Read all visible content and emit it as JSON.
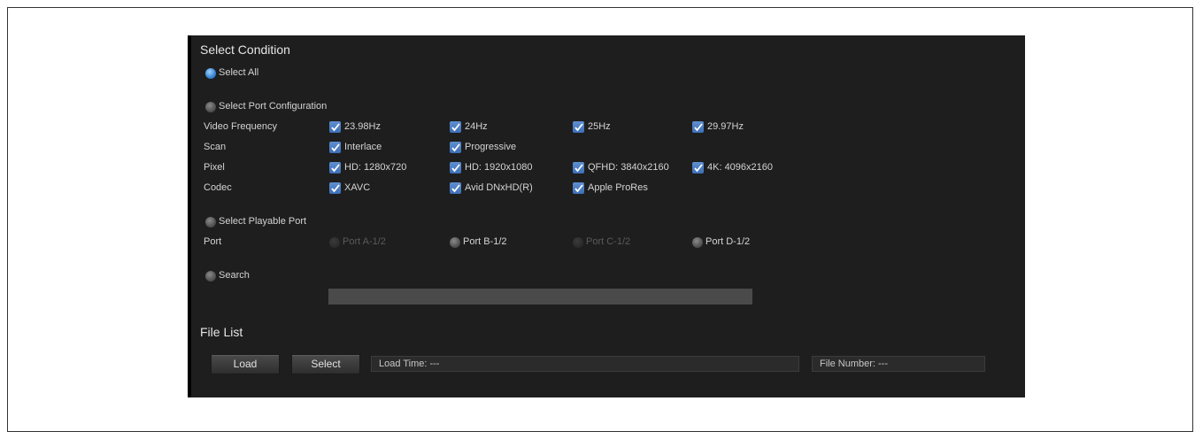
{
  "select_condition": {
    "title": "Select Condition",
    "select_all": "Select All",
    "select_port_configuration": "Select Port Configuration",
    "rows": [
      {
        "label": "Video Frequency",
        "options": [
          "23.98Hz",
          "24Hz",
          "25Hz",
          "29.97Hz"
        ]
      },
      {
        "label": "Scan",
        "options": [
          "Interlace",
          "Progressive"
        ]
      },
      {
        "label": "Pixel",
        "options": [
          "HD: 1280x720",
          "HD: 1920x1080",
          "QFHD: 3840x2160",
          "4K: 4096x2160"
        ]
      },
      {
        "label": "Codec",
        "options": [
          "XAVC",
          "Avid DNxHD(R)",
          "Apple ProRes"
        ]
      }
    ],
    "select_playable_port": "Select Playable Port",
    "port_label": "Port",
    "ports": [
      "Port A-1/2",
      "Port B-1/2",
      "Port C-1/2",
      "Port D-1/2"
    ],
    "search": "Search"
  },
  "file_list": {
    "title": "File List",
    "load_button": "Load",
    "select_button": "Select",
    "load_time": "Load Time: ---",
    "file_number": "File Number: ---"
  },
  "colors": {
    "accent": "#3d6fb8",
    "panel": "#1e1e1e"
  }
}
